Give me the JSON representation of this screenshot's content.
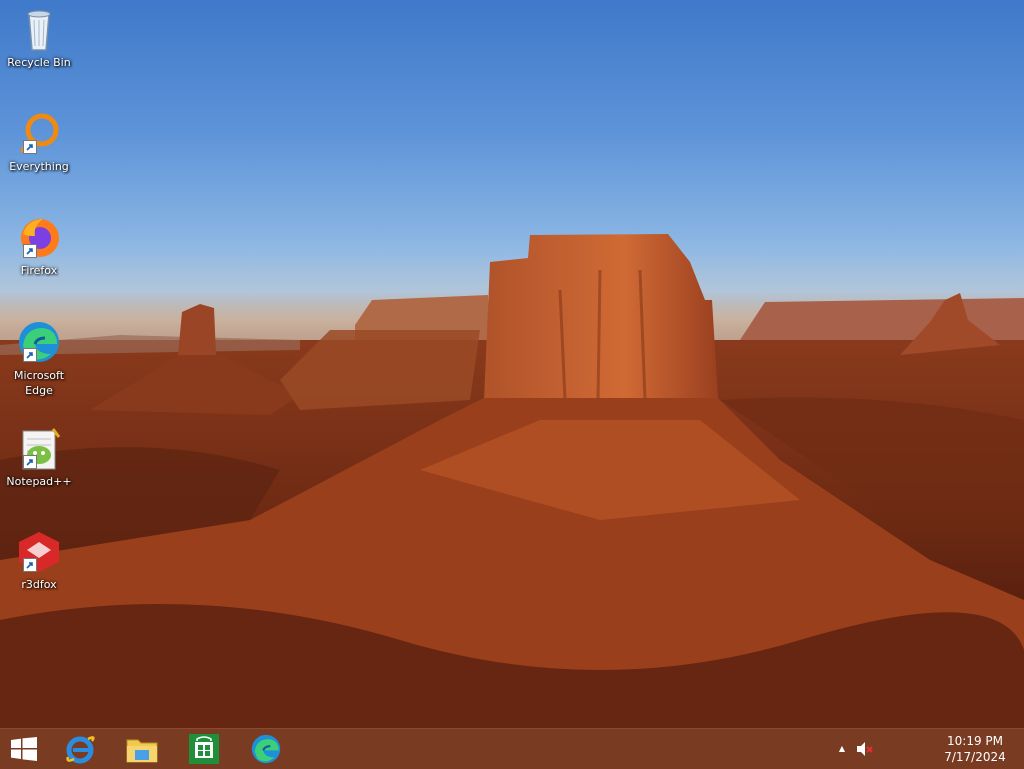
{
  "desktop": {
    "icons": [
      {
        "label": "Recycle Bin",
        "icon": "recycle-bin-icon"
      },
      {
        "label": "Everything",
        "icon": "everything-icon"
      },
      {
        "label": "Firefox",
        "icon": "firefox-icon"
      },
      {
        "label": "Microsoft Edge",
        "icon": "edge-icon"
      },
      {
        "label": "Notepad++",
        "icon": "notepadpp-icon"
      },
      {
        "label": "r3dfox",
        "icon": "r3dfox-icon"
      }
    ]
  },
  "taskbar": {
    "pinned": [
      "start-button",
      "internet-explorer",
      "file-explorer",
      "store",
      "microsoft-edge"
    ],
    "clock": {
      "time": "10:19 PM",
      "date": "7/17/2024"
    },
    "tray": {
      "chevron": "▲",
      "volume_muted": true
    }
  },
  "colors": {
    "taskbar": "#7a3b23",
    "sky": "#5d93d8",
    "rock": "#9c4a25"
  }
}
